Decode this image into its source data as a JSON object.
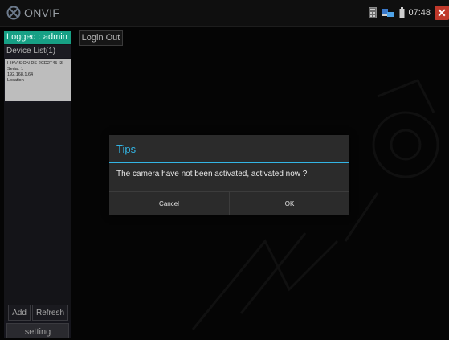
{
  "app": {
    "title": "ONVIF"
  },
  "status_bar": {
    "time": "07:48",
    "icons": [
      "calculator-icon",
      "network-icon",
      "battery-icon",
      "close-icon"
    ],
    "close_label": "✕"
  },
  "sidebar": {
    "logged_label": "Logged : admin",
    "device_list_label": "Device List(1)",
    "devices": [
      {
        "name": "HIKVISION DS-2CD2T45-I3",
        "serial": "Serial: 1",
        "ip": "192.168.1.64",
        "location": "Location"
      }
    ],
    "add_label": "Add",
    "refresh_label": "Refresh",
    "setting_label": "setting"
  },
  "main": {
    "logout_label": "Login Out"
  },
  "dialog": {
    "title": "Tips",
    "message": "The camera have not been activated, activated now ?",
    "cancel_label": "Cancel",
    "ok_label": "OK"
  },
  "colors": {
    "accent_blue": "#33b5e5",
    "logged_green": "#17a085",
    "close_red": "#c0392b"
  }
}
